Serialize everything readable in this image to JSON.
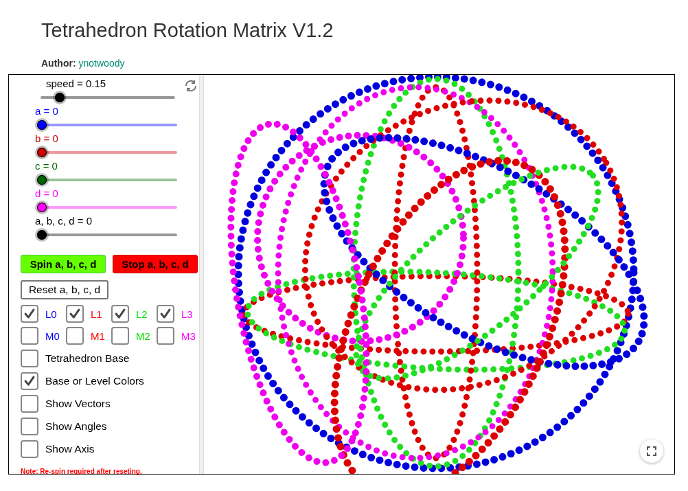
{
  "title": "Tetrahedron Rotation Matrix V1.2",
  "author": {
    "label": "Author:",
    "name": "ynotwoody"
  },
  "sliders": [
    {
      "label": "speed = 0.15",
      "level": 0.11,
      "color": "#000000"
    },
    {
      "label": "a = 0",
      "level": 0,
      "color": "#0000ff"
    },
    {
      "label": "b = 0",
      "level": 0,
      "color": "#cc0000"
    },
    {
      "label": "c = 0",
      "level": 0,
      "color": "#006600"
    },
    {
      "label": "d = 0",
      "level": 0,
      "color": "#ff00ff"
    },
    {
      "label": "a, b, c, d = 0",
      "level": 0,
      "color": "#000000"
    }
  ],
  "buttons": [
    {
      "label": "Spin a, b, c, d",
      "kind": "spin"
    },
    {
      "label": "Stop a, b, c, d",
      "kind": "stop"
    },
    {
      "label": "Reset a, b, c, d",
      "kind": "plain"
    }
  ],
  "line_checks": [
    {
      "label": "L0",
      "checked": true,
      "color": "#0000ff"
    },
    {
      "label": "L1",
      "checked": true,
      "color": "#ff0000"
    },
    {
      "label": "L2",
      "checked": true,
      "color": "#00dd00"
    },
    {
      "label": "L3",
      "checked": true,
      "color": "#ff00ff"
    },
    {
      "label": "M0",
      "checked": false,
      "color": "#0000ff"
    },
    {
      "label": "M1",
      "checked": false,
      "color": "#ff0000"
    },
    {
      "label": "M2",
      "checked": false,
      "color": "#00dd00"
    },
    {
      "label": "M3",
      "checked": false,
      "color": "#ff00ff"
    }
  ],
  "options": [
    {
      "label": "Tetrahedron Base",
      "checked": false
    },
    {
      "label": "Base or Level Colors",
      "checked": true
    },
    {
      "label": "Show Vectors",
      "checked": false
    },
    {
      "label": "Show Angles",
      "checked": false
    },
    {
      "label": "Show Axis",
      "checked": false
    }
  ],
  "note": "Note: Re-spin required after reseting."
}
